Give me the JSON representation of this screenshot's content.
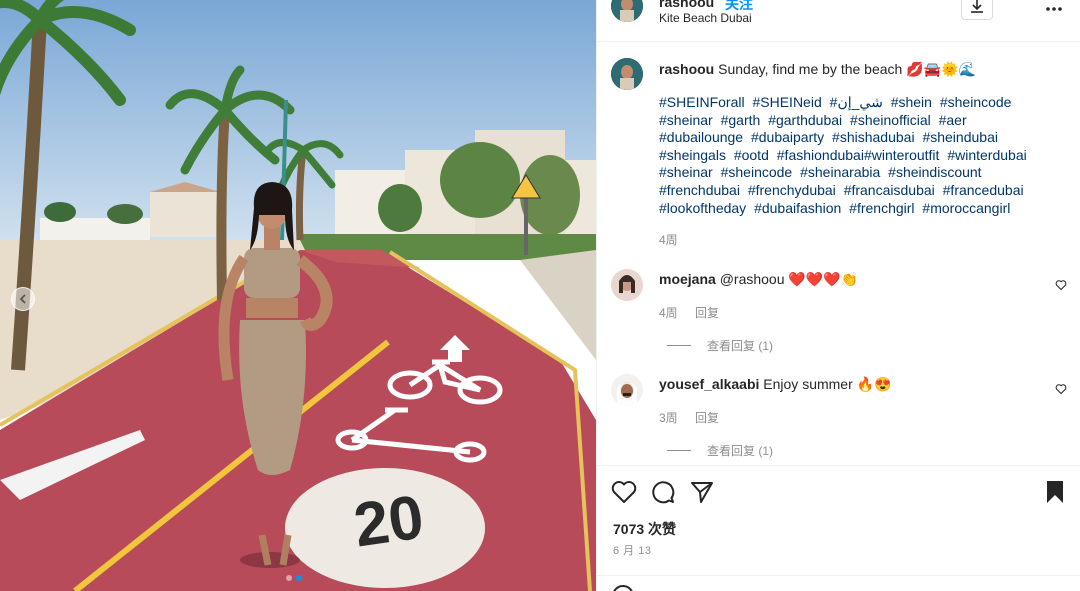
{
  "header": {
    "username": "rashoou",
    "follow_label": "关注",
    "location": "Kite Beach Dubai",
    "more_icon": "more-horizontal-icon",
    "save_icon": "download-icon"
  },
  "caption": {
    "username": "rashoou",
    "text": "Sunday, find me by the beach 💋🚘🌞🌊",
    "hashtags": [
      "#SHEINForall",
      "#SHEINeid",
      "#شي_إن",
      "#shein",
      "#sheincode",
      "#sheinar",
      "#garth",
      "#garthdubai",
      "#sheinofficial",
      "#aer",
      "#dubailounge",
      "#dubaiparty",
      "#shishadubai",
      "#sheindubai",
      "#sheingals",
      "#ootd",
      "#fashiondubai#winteroutfit",
      "#winterdubai",
      "#sheinar",
      "#sheincode",
      "#sheinarabia",
      "#sheindiscount",
      "#frenchdubai",
      "#frenchydubai",
      "#francaisdubai",
      "#francedubai",
      "#lookoftheday",
      "#dubaifashion",
      "#frenchgirl",
      "#moroccangirl"
    ],
    "time": "4周"
  },
  "comments": [
    {
      "username": "moejana",
      "text": "@rashoou ❤️❤️❤️👏",
      "time": "4周",
      "reply_label": "回复",
      "view_replies": "查看回复 (1)"
    },
    {
      "username": "yousef_alkaabi",
      "text": "Enjoy summer 🔥😍",
      "time": "3周",
      "reply_label": "回复",
      "view_replies": "查看回复 (1)"
    }
  ],
  "actions": {
    "icons": [
      "heart-icon",
      "comment-icon",
      "share-icon",
      "bookmark-icon"
    ]
  },
  "likes": "7073 次赞",
  "date": "6 月 13",
  "photo": {
    "road_marking": "20",
    "carousel": {
      "count": 2,
      "active": 1
    }
  },
  "colors": {
    "link": "#00376b",
    "accent": "#0095f6",
    "muted": "#8e8e8e",
    "road": "#b84b5a"
  }
}
